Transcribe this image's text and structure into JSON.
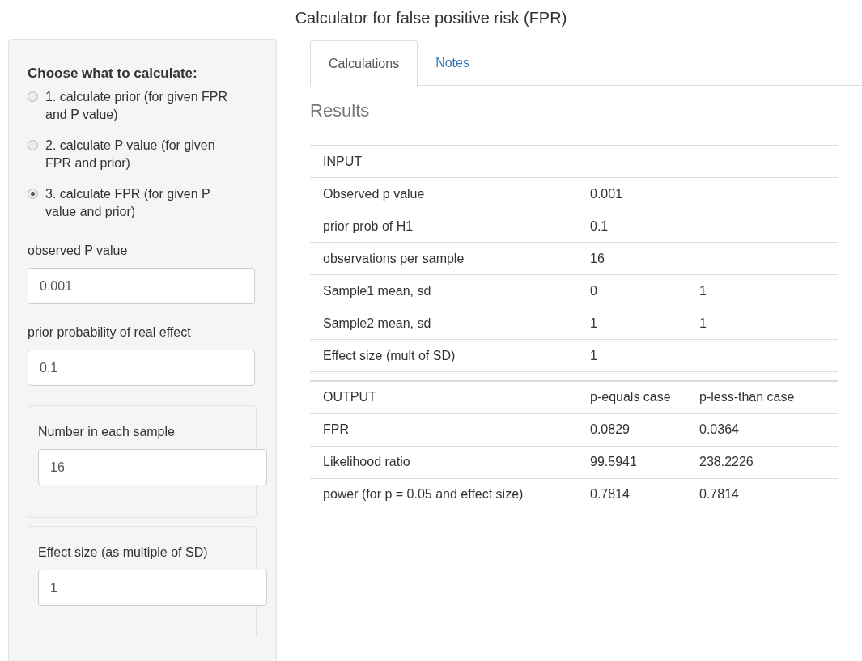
{
  "title": "Calculator for false positive risk (FPR)",
  "sidebar": {
    "heading": "Choose what to calculate:",
    "options": [
      {
        "label": "1. calculate prior (for given FPR and P value)",
        "selected": false
      },
      {
        "label": "2. calculate P value (for given FPR and prior)",
        "selected": false
      },
      {
        "label": "3. calculate FPR (for given P value and prior)",
        "selected": true
      }
    ],
    "fields": [
      {
        "kind": "plain",
        "label": "observed P value",
        "value": "0.001"
      },
      {
        "kind": "plain",
        "label": "prior probability of real effect",
        "value": "0.1"
      },
      {
        "kind": "well",
        "label": "Number in each sample",
        "value": "16"
      },
      {
        "kind": "well",
        "label": "Effect size (as multiple of SD)",
        "value": "1"
      }
    ]
  },
  "tabs": [
    {
      "label": "Calculations",
      "selected": true
    },
    {
      "label": "Notes",
      "selected": false
    }
  ],
  "results": {
    "heading": "Results",
    "tables": [
      {
        "rows": [
          [
            "INPUT"
          ],
          [
            "Observed p value",
            "0.001"
          ],
          [
            "prior prob of H1",
            "0.1"
          ],
          [
            "observations per sample",
            "16"
          ],
          [
            "Sample1 mean, sd",
            "0",
            "1"
          ],
          [
            "Sample2 mean, sd",
            "1",
            "1"
          ],
          [
            "Effect size (mult of SD)",
            "1"
          ]
        ]
      },
      {
        "rows": [
          [
            "OUTPUT",
            "p-equals case",
            "p-less-than case"
          ],
          [
            "FPR",
            "0.0829",
            "0.0364"
          ],
          [
            "Likelihood ratio",
            "99.5941",
            "238.2226"
          ],
          [
            "power (for p = 0.05 and effect size)",
            "0.7814",
            "0.7814"
          ]
        ]
      }
    ]
  }
}
